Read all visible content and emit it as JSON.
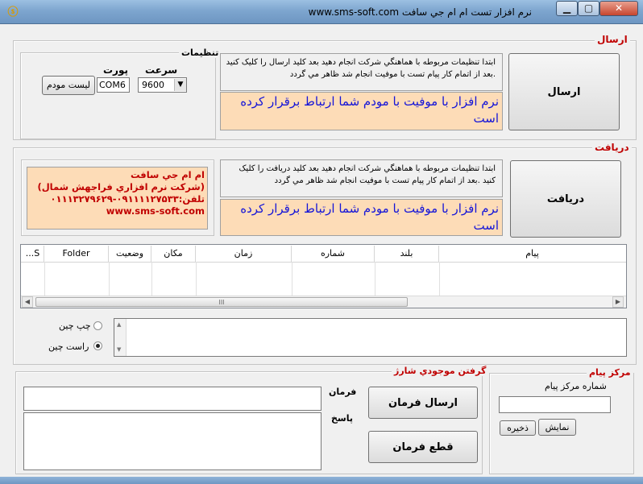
{
  "window": {
    "title": "نرم افزار تست ام ام جي سافت  www.sms-soft.com",
    "icon": "app-logo-icon",
    "controls": {
      "minimize": "▁",
      "maximize": "▢",
      "close": "✕"
    }
  },
  "send_section": {
    "title": "ارسال",
    "settings": {
      "title": "تنظيمات",
      "speed_label": "سرعت",
      "port_label": "پورت",
      "speed_value": "9600",
      "port_value": "COM6",
      "modem_list_button": "ليست مودم"
    },
    "info_text": "ابتدا تنظيمات مربوطه با هماهنگي شرکت  انجام دهيد بعد کليد ارسال را کليک کنيد .بعد از اتمام کار پيام تست با موفيت انجام شد ظاهر مي گردد",
    "status_text": "نرم افزار با موفيت با مودم شما ارتباط برقرار کرده است",
    "send_button": "ارسال"
  },
  "receive_section": {
    "title": "دريافت",
    "company": {
      "line1": "ام ام جي سافت",
      "line2": "(شرکت نرم افزاري فراجهش شمال)",
      "line3": "تلفن:۰۹۱۱۱۱۲۷۵۳۳-۰۱۱۱۳۲۷۹۶۲۹",
      "line4": "www.sms-soft.com"
    },
    "info_text": "ابتدا تنظيمات مربوطه با هماهنگي شرکت  انجام دهيد بعد کليد دريافت را کليک کنيد .بعد از اتمام کار پيام تست با موفيت انجام شد ظاهر مي گردد",
    "status_text": "نرم افزار با موفيت با مودم شما ارتباط برقرار کرده است",
    "receive_button": "دريافت"
  },
  "grid": {
    "columns": [
      "S...",
      "Folder",
      "وضعيت",
      "مکان",
      "زمان",
      "شماره",
      "بلند",
      "پيام"
    ],
    "rows": [],
    "scroll_thumb": "III"
  },
  "direction": {
    "ltr_label": "چپ چين",
    "rtl_label": "راست چين",
    "selected": "راست چين"
  },
  "charge_section": {
    "title": "گرفتن موجودي شارژ",
    "command_label": "فرمان",
    "reply_label": "پاسخ",
    "send_command_button": "ارسال فرمان",
    "stop_command_button": "قطع فرمان",
    "command_value": "",
    "reply_value": ""
  },
  "message_center": {
    "title": "مرکز پيام",
    "number_label": "شماره مرکز پيام",
    "number_value": "",
    "show_button": "نمايش",
    "save_button": "ذخيره"
  },
  "colors": {
    "group_title": "#c00000",
    "status_background": "#fddcb7",
    "status_text": "#1515d8",
    "company_background": "#fddcb7",
    "company_text": "#c00000"
  }
}
